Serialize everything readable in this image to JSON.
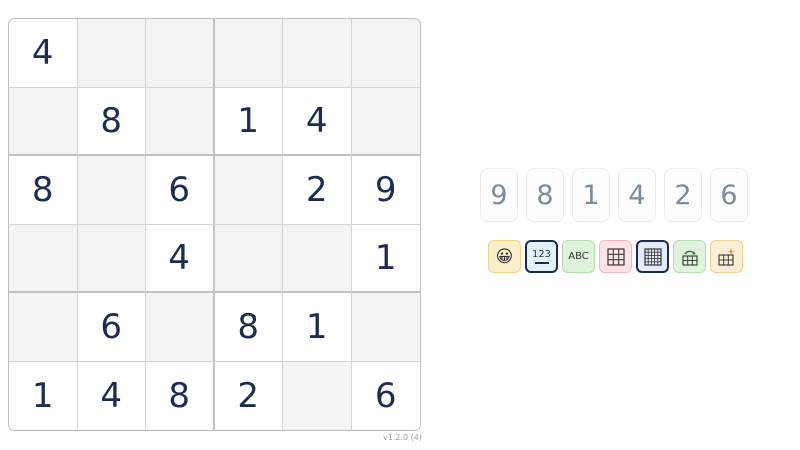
{
  "board": {
    "rows": [
      [
        "4",
        "",
        "",
        "",
        "",
        ""
      ],
      [
        "",
        "8",
        "",
        "1",
        "4",
        ""
      ],
      [
        "8",
        "",
        "6",
        "",
        "2",
        "9"
      ],
      [
        "",
        "",
        "4",
        "",
        "",
        "1"
      ],
      [
        "",
        "6",
        "",
        "8",
        "1",
        ""
      ],
      [
        "1",
        "4",
        "8",
        "2",
        "",
        "6"
      ]
    ]
  },
  "version": "v1.2.0 (4)",
  "number_pad": [
    "9",
    "8",
    "1",
    "4",
    "2",
    "6"
  ],
  "tools": {
    "smiley": "😀",
    "numbers_label": "123",
    "letters_label": "ABC"
  }
}
